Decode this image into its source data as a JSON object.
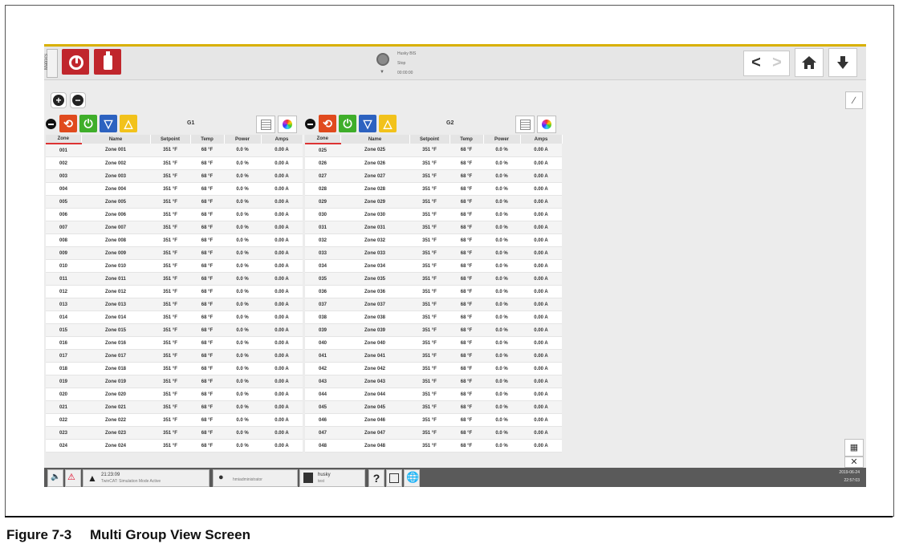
{
  "topbar": {
    "side_tab": "MatrixS",
    "status_line1": "Husky BIS",
    "status_line2": "Stop",
    "status_line3": "00:00:00",
    "nav_back": "<",
    "nav_forward": ">"
  },
  "columns": [
    "Zone",
    "Name",
    "Setpoint",
    "Temp",
    "Power",
    "Amps"
  ],
  "groups": [
    {
      "name": "G1",
      "rows": [
        [
          "001",
          "Zone 001",
          "351 °F",
          "68 °F",
          "0.0 %",
          "0.00 A"
        ],
        [
          "002",
          "Zone 002",
          "351 °F",
          "68 °F",
          "0.0 %",
          "0.00 A"
        ],
        [
          "003",
          "Zone 003",
          "351 °F",
          "68 °F",
          "0.0 %",
          "0.00 A"
        ],
        [
          "004",
          "Zone 004",
          "351 °F",
          "68 °F",
          "0.0 %",
          "0.00 A"
        ],
        [
          "005",
          "Zone 005",
          "351 °F",
          "68 °F",
          "0.0 %",
          "0.00 A"
        ],
        [
          "006",
          "Zone 006",
          "351 °F",
          "68 °F",
          "0.0 %",
          "0.00 A"
        ],
        [
          "007",
          "Zone 007",
          "351 °F",
          "68 °F",
          "0.0 %",
          "0.00 A"
        ],
        [
          "008",
          "Zone 008",
          "351 °F",
          "68 °F",
          "0.0 %",
          "0.00 A"
        ],
        [
          "009",
          "Zone 009",
          "351 °F",
          "68 °F",
          "0.0 %",
          "0.00 A"
        ],
        [
          "010",
          "Zone 010",
          "351 °F",
          "68 °F",
          "0.0 %",
          "0.00 A"
        ],
        [
          "011",
          "Zone 011",
          "351 °F",
          "68 °F",
          "0.0 %",
          "0.00 A"
        ],
        [
          "012",
          "Zone 012",
          "351 °F",
          "68 °F",
          "0.0 %",
          "0.00 A"
        ],
        [
          "013",
          "Zone 013",
          "351 °F",
          "68 °F",
          "0.0 %",
          "0.00 A"
        ],
        [
          "014",
          "Zone 014",
          "351 °F",
          "68 °F",
          "0.0 %",
          "0.00 A"
        ],
        [
          "015",
          "Zone 015",
          "351 °F",
          "68 °F",
          "0.0 %",
          "0.00 A"
        ],
        [
          "016",
          "Zone 016",
          "351 °F",
          "68 °F",
          "0.0 %",
          "0.00 A"
        ],
        [
          "017",
          "Zone 017",
          "351 °F",
          "68 °F",
          "0.0 %",
          "0.00 A"
        ],
        [
          "018",
          "Zone 018",
          "351 °F",
          "68 °F",
          "0.0 %",
          "0.00 A"
        ],
        [
          "019",
          "Zone 019",
          "351 °F",
          "68 °F",
          "0.0 %",
          "0.00 A"
        ],
        [
          "020",
          "Zone 020",
          "351 °F",
          "68 °F",
          "0.0 %",
          "0.00 A"
        ],
        [
          "021",
          "Zone 021",
          "351 °F",
          "68 °F",
          "0.0 %",
          "0.00 A"
        ],
        [
          "022",
          "Zone 022",
          "351 °F",
          "68 °F",
          "0.0 %",
          "0.00 A"
        ],
        [
          "023",
          "Zone 023",
          "351 °F",
          "68 °F",
          "0.0 %",
          "0.00 A"
        ],
        [
          "024",
          "Zone 024",
          "351 °F",
          "68 °F",
          "0.0 %",
          "0.00 A"
        ]
      ]
    },
    {
      "name": "G2",
      "rows": [
        [
          "025",
          "Zone 025",
          "351 °F",
          "68 °F",
          "0.0 %",
          "0.00 A"
        ],
        [
          "026",
          "Zone 026",
          "351 °F",
          "68 °F",
          "0.0 %",
          "0.00 A"
        ],
        [
          "027",
          "Zone 027",
          "351 °F",
          "68 °F",
          "0.0 %",
          "0.00 A"
        ],
        [
          "028",
          "Zone 028",
          "351 °F",
          "68 °F",
          "0.0 %",
          "0.00 A"
        ],
        [
          "029",
          "Zone 029",
          "351 °F",
          "68 °F",
          "0.0 %",
          "0.00 A"
        ],
        [
          "030",
          "Zone 030",
          "351 °F",
          "68 °F",
          "0.0 %",
          "0.00 A"
        ],
        [
          "031",
          "Zone 031",
          "351 °F",
          "68 °F",
          "0.0 %",
          "0.00 A"
        ],
        [
          "032",
          "Zone 032",
          "351 °F",
          "68 °F",
          "0.0 %",
          "0.00 A"
        ],
        [
          "033",
          "Zone 033",
          "351 °F",
          "68 °F",
          "0.0 %",
          "0.00 A"
        ],
        [
          "034",
          "Zone 034",
          "351 °F",
          "68 °F",
          "0.0 %",
          "0.00 A"
        ],
        [
          "035",
          "Zone 035",
          "351 °F",
          "68 °F",
          "0.0 %",
          "0.00 A"
        ],
        [
          "036",
          "Zone 036",
          "351 °F",
          "68 °F",
          "0.0 %",
          "0.00 A"
        ],
        [
          "037",
          "Zone 037",
          "351 °F",
          "68 °F",
          "0.0 %",
          "0.00 A"
        ],
        [
          "038",
          "Zone 038",
          "351 °F",
          "68 °F",
          "0.0 %",
          "0.00 A"
        ],
        [
          "039",
          "Zone 039",
          "351 °F",
          "68 °F",
          "0.0 %",
          "0.00 A"
        ],
        [
          "040",
          "Zone 040",
          "351 °F",
          "68 °F",
          "0.0 %",
          "0.00 A"
        ],
        [
          "041",
          "Zone 041",
          "351 °F",
          "68 °F",
          "0.0 %",
          "0.00 A"
        ],
        [
          "042",
          "Zone 042",
          "351 °F",
          "68 °F",
          "0.0 %",
          "0.00 A"
        ],
        [
          "043",
          "Zone 043",
          "351 °F",
          "68 °F",
          "0.0 %",
          "0.00 A"
        ],
        [
          "044",
          "Zone 044",
          "351 °F",
          "68 °F",
          "0.0 %",
          "0.00 A"
        ],
        [
          "045",
          "Zone 045",
          "351 °F",
          "68 °F",
          "0.0 %",
          "0.00 A"
        ],
        [
          "046",
          "Zone 046",
          "351 °F",
          "68 °F",
          "0.0 %",
          "0.00 A"
        ],
        [
          "047",
          "Zone 047",
          "351 °F",
          "68 °F",
          "0.0 %",
          "0.00 A"
        ],
        [
          "048",
          "Zone 048",
          "351 °F",
          "68 °F",
          "0.0 %",
          "0.00 A"
        ]
      ]
    }
  ],
  "bottombar": {
    "alarm_time": "21:23:09",
    "alarm_text": "TwinCAT: Simulation Mode Active",
    "user": "hmiadministrator",
    "mold_name": "husky",
    "mold_sub": "test",
    "help": "?",
    "date": "2019-06-24",
    "time": "22:57:03"
  },
  "caption": {
    "number": "Figure 7-3",
    "title": "Multi Group View Screen"
  },
  "colors": {
    "accent": "#d8b000",
    "red_button": "#c0262c",
    "group_stop": "#e04a1e",
    "group_power": "#3fae2a",
    "group_down": "#2d62c0",
    "group_warn": "#f2c21b",
    "bottombar": "#5a5a5a"
  }
}
